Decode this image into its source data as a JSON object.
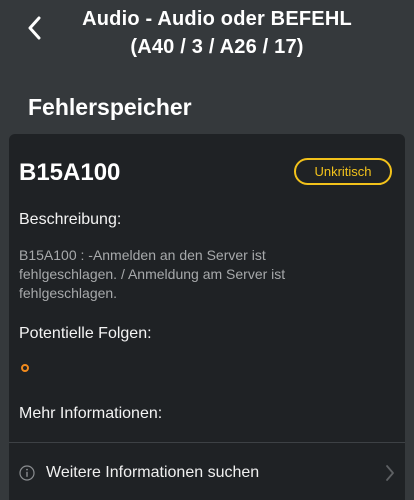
{
  "header": {
    "title_line1": "Audio - Audio oder BEFEHL",
    "title_line2": "(A40 / 3 / A26 / 17)"
  },
  "section_title": "Fehlerspeicher",
  "fault": {
    "code": "B15A100",
    "severity": "Unkritisch",
    "description_label": "Beschreibung:",
    "description_lines": [
      "B15A100 :  -Anmelden an den Server ist",
      "fehlgeschlagen. /  Anmeldung am Server ist",
      "fehlgeschlagen."
    ],
    "consequences_label": "Potentielle Folgen:",
    "more_info_label": "Mehr Informationen:",
    "more_info_action": "Weitere Informationen suchen"
  },
  "colors": {
    "background": "#35393c",
    "card": "#1f2225",
    "badge": "#f2c21b",
    "bullet": "#f08a1d"
  },
  "icons": {
    "back": "chevron-left-icon",
    "info": "info-circle-icon",
    "next": "chevron-right-icon"
  }
}
